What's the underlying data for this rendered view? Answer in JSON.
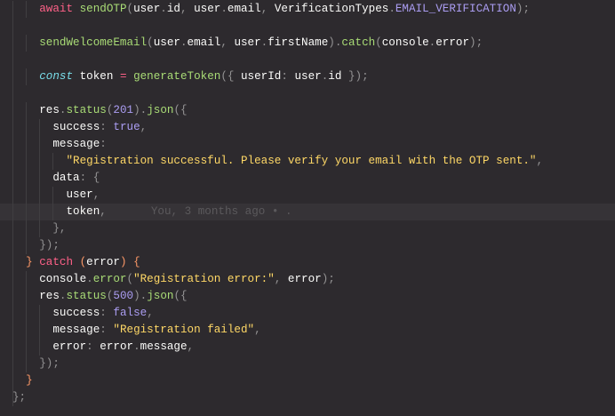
{
  "colors": {
    "background": "#2d2a2e",
    "keyword": "#ff6188",
    "function": "#a9dc76",
    "string": "#ffd866",
    "constant": "#ab9df2",
    "storage": "#78dce8",
    "punctuation": "#939293",
    "text": "#fcfcfa"
  },
  "lines": [
    {
      "indent": 2,
      "tokens": [
        [
          "kw",
          "await"
        ],
        [
          "t",
          " "
        ],
        [
          "fn",
          "sendOTP"
        ],
        [
          "p",
          "("
        ],
        [
          "t",
          "user"
        ],
        [
          "p",
          "."
        ],
        [
          "t",
          "id"
        ],
        [
          "p",
          ", "
        ],
        [
          "t",
          "user"
        ],
        [
          "p",
          "."
        ],
        [
          "t",
          "email"
        ],
        [
          "p",
          ", "
        ],
        [
          "t",
          "VerificationTypes"
        ],
        [
          "p",
          "."
        ],
        [
          "cst",
          "EMAIL_VERIFICATION"
        ],
        [
          "p",
          ");"
        ]
      ]
    },
    {
      "indent": 0,
      "tokens": []
    },
    {
      "indent": 2,
      "tokens": [
        [
          "fn",
          "sendWelcomeEmail"
        ],
        [
          "p",
          "("
        ],
        [
          "t",
          "user"
        ],
        [
          "p",
          "."
        ],
        [
          "t",
          "email"
        ],
        [
          "p",
          ", "
        ],
        [
          "t",
          "user"
        ],
        [
          "p",
          "."
        ],
        [
          "t",
          "firstName"
        ],
        [
          "p",
          ")."
        ],
        [
          "fn",
          "catch"
        ],
        [
          "p",
          "("
        ],
        [
          "t",
          "console"
        ],
        [
          "p",
          "."
        ],
        [
          "t",
          "error"
        ],
        [
          "p",
          ");"
        ]
      ]
    },
    {
      "indent": 0,
      "tokens": []
    },
    {
      "indent": 2,
      "tokens": [
        [
          "st",
          "const"
        ],
        [
          "t",
          " token "
        ],
        [
          "kw",
          "="
        ],
        [
          "t",
          " "
        ],
        [
          "fn",
          "generateToken"
        ],
        [
          "p",
          "({ "
        ],
        [
          "t",
          "userId"
        ],
        [
          "p",
          ": "
        ],
        [
          "t",
          "user"
        ],
        [
          "p",
          "."
        ],
        [
          "t",
          "id"
        ],
        [
          "p",
          " });"
        ]
      ]
    },
    {
      "indent": 0,
      "tokens": []
    },
    {
      "indent": 2,
      "tokens": [
        [
          "t",
          "res"
        ],
        [
          "p",
          "."
        ],
        [
          "fn",
          "status"
        ],
        [
          "p",
          "("
        ],
        [
          "cst",
          "201"
        ],
        [
          "p",
          ")."
        ],
        [
          "fn",
          "json"
        ],
        [
          "p",
          "({"
        ]
      ]
    },
    {
      "indent": 3,
      "tokens": [
        [
          "t",
          "success"
        ],
        [
          "p",
          ": "
        ],
        [
          "cst",
          "true"
        ],
        [
          "p",
          ","
        ]
      ]
    },
    {
      "indent": 3,
      "tokens": [
        [
          "t",
          "message"
        ],
        [
          "p",
          ":"
        ]
      ]
    },
    {
      "indent": 4,
      "tokens": [
        [
          "str",
          "\"Registration successful. Please verify your email with the OTP sent.\""
        ],
        [
          "p",
          ","
        ]
      ]
    },
    {
      "indent": 3,
      "tokens": [
        [
          "t",
          "data"
        ],
        [
          "p",
          ": {"
        ]
      ]
    },
    {
      "indent": 4,
      "tokens": [
        [
          "t",
          "user"
        ],
        [
          "p",
          ","
        ]
      ]
    },
    {
      "indent": 4,
      "highlight": true,
      "tokens": [
        [
          "t",
          "token"
        ],
        [
          "p",
          ","
        ]
      ],
      "blame": "You, 3 months ago • ."
    },
    {
      "indent": 3,
      "tokens": [
        [
          "p",
          "},"
        ]
      ]
    },
    {
      "indent": 2,
      "tokens": [
        [
          "p",
          "});"
        ]
      ]
    },
    {
      "indent": 1,
      "tokens": [
        [
          "par",
          "}"
        ],
        [
          "t",
          " "
        ],
        [
          "kw",
          "catch"
        ],
        [
          "t",
          " "
        ],
        [
          "par",
          "("
        ],
        [
          "t",
          "error"
        ],
        [
          "par",
          ")"
        ],
        [
          "t",
          " "
        ],
        [
          "par",
          "{"
        ]
      ]
    },
    {
      "indent": 2,
      "tokens": [
        [
          "t",
          "console"
        ],
        [
          "p",
          "."
        ],
        [
          "fn",
          "error"
        ],
        [
          "p",
          "("
        ],
        [
          "str",
          "\"Registration error:\""
        ],
        [
          "p",
          ", "
        ],
        [
          "t",
          "error"
        ],
        [
          "p",
          ");"
        ]
      ]
    },
    {
      "indent": 2,
      "tokens": [
        [
          "t",
          "res"
        ],
        [
          "p",
          "."
        ],
        [
          "fn",
          "status"
        ],
        [
          "p",
          "("
        ],
        [
          "cst",
          "500"
        ],
        [
          "p",
          ")."
        ],
        [
          "fn",
          "json"
        ],
        [
          "p",
          "({"
        ]
      ]
    },
    {
      "indent": 3,
      "tokens": [
        [
          "t",
          "success"
        ],
        [
          "p",
          ": "
        ],
        [
          "cst",
          "false"
        ],
        [
          "p",
          ","
        ]
      ]
    },
    {
      "indent": 3,
      "tokens": [
        [
          "t",
          "message"
        ],
        [
          "p",
          ": "
        ],
        [
          "str",
          "\"Registration failed\""
        ],
        [
          "p",
          ","
        ]
      ]
    },
    {
      "indent": 3,
      "tokens": [
        [
          "t",
          "error"
        ],
        [
          "p",
          ": "
        ],
        [
          "t",
          "error"
        ],
        [
          "p",
          "."
        ],
        [
          "t",
          "message"
        ],
        [
          "p",
          ","
        ]
      ]
    },
    {
      "indent": 2,
      "tokens": [
        [
          "p",
          "});"
        ]
      ]
    },
    {
      "indent": 1,
      "tokens": [
        [
          "par",
          "}"
        ]
      ]
    },
    {
      "indent": 0,
      "tokens": [
        [
          "p",
          "};"
        ]
      ]
    }
  ]
}
